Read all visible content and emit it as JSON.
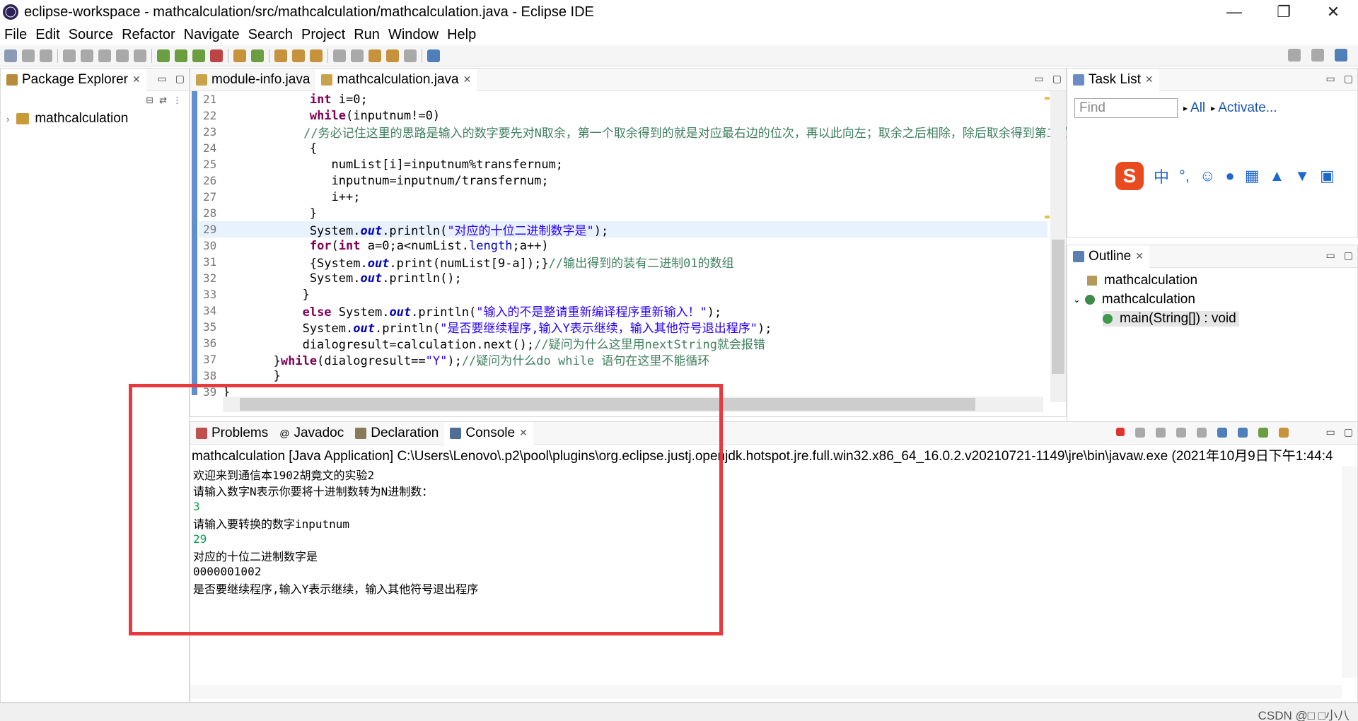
{
  "window": {
    "title": "eclipse-workspace - mathcalculation/src/mathcalculation/mathcalculation.java - Eclipse IDE",
    "controls": [
      "—",
      "❐",
      "✕"
    ]
  },
  "menu": [
    "File",
    "Edit",
    "Source",
    "Refactor",
    "Navigate",
    "Search",
    "Project",
    "Run",
    "Window",
    "Help"
  ],
  "package_explorer": {
    "tab": "Package Explorer",
    "project": "mathcalculation"
  },
  "editor": {
    "tabs": [
      {
        "label": "module-info.java"
      },
      {
        "label": "mathcalculation.java"
      }
    ],
    "lines": [
      {
        "num": "21",
        "code": "            int i=0;"
      },
      {
        "num": "22",
        "code": "            while(inputnum!=0)"
      },
      {
        "num": "23",
        "code": "            //务必记住这里的思路是输入的数字要先对N取余，第一个取余得到的就是对应最右边的位次，再以此向左；取余之后相除，除后取余得到第二位数字以后向后"
      },
      {
        "num": "24",
        "code": "            {"
      },
      {
        "num": "25",
        "code": "               numList[i]=inputnum%transfernum;"
      },
      {
        "num": "26",
        "code": "               inputnum=inputnum/transfernum;"
      },
      {
        "num": "27",
        "code": "               i++;"
      },
      {
        "num": "28",
        "code": "            }"
      },
      {
        "num": "29",
        "code": "            System.out.println(\"对应的十位二进制数字是\");"
      },
      {
        "num": "30",
        "code": "            for(int a=0;a<numList.length;a++)"
      },
      {
        "num": "31",
        "code": "            {System.out.print(numList[9-a]);}//输出得到的装有二进制01的数组"
      },
      {
        "num": "32",
        "code": "            System.out.println();"
      },
      {
        "num": "33",
        "code": "           }"
      },
      {
        "num": "34",
        "code": "           else System.out.println(\"输入的不是整请重新编译程序重新输入！\");"
      },
      {
        "num": "35",
        "code": "           System.out.println(\"是否要继续程序,输入Y表示继续，输入其他符号退出程序\");"
      },
      {
        "num": "36",
        "code": "           dialogresult=calculation.next();//疑问为什么这里用nextString就会报错"
      },
      {
        "num": "37",
        "code": "       }while(dialogresult==\"Y\");//疑问为什么do while 语句在这里不能循环"
      },
      {
        "num": "38",
        "code": "       }"
      },
      {
        "num": "39",
        "code": "}"
      }
    ]
  },
  "task_list": {
    "tab": "Task List",
    "find_placeholder": "Find",
    "all_label": "All",
    "activate_label": "Activate...",
    "ime_zh": "中"
  },
  "outline": {
    "tab": "Outline",
    "items": [
      "mathcalculation",
      "mathcalculation",
      "main(String[]) : void"
    ]
  },
  "bottom_tabs": [
    "Problems",
    "Javadoc",
    "Declaration",
    "Console"
  ],
  "console": {
    "launch": "mathcalculation [Java Application] C:\\Users\\Lenovo\\.p2\\pool\\plugins\\org.eclipse.justj.openjdk.hotspot.jre.full.win32.x86_64_16.0.2.v20210721-1149\\jre\\bin\\javaw.exe  (2021年10月9日下午1:44:4",
    "output": [
      {
        "text": "欢迎来到通信本1902胡竟文的实验2",
        "input": false
      },
      {
        "text": "请输入数字N表示你要将十进制数转为N进制数：",
        "input": false
      },
      {
        "text": "3",
        "input": true
      },
      {
        "text": "请输入要转换的数字inputnum",
        "input": false
      },
      {
        "text": "29",
        "input": true
      },
      {
        "text": "对应的十位二进制数字是",
        "input": false
      },
      {
        "text": "0000001002",
        "input": false
      },
      {
        "text": "是否要继续程序,输入Y表示继续，输入其他符号退出程序",
        "input": false
      }
    ]
  },
  "watermark": "CSDN @□ □小八",
  "colors": {
    "highlight_box": "#e8393c",
    "keyword": "#7f0055",
    "string": "#2a00ff",
    "comment": "#3f7f5f",
    "console_input": "#0b9b50"
  }
}
